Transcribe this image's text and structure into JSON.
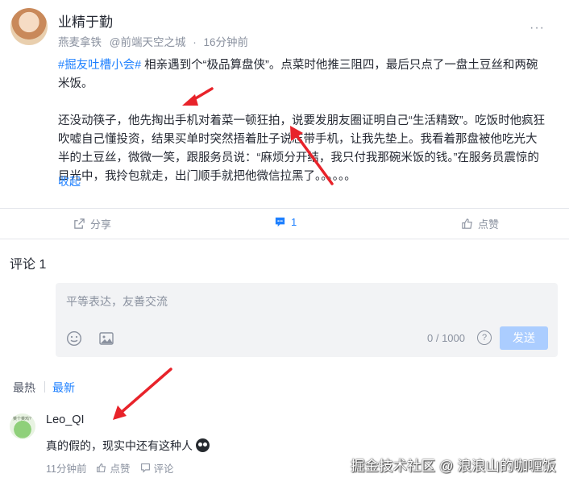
{
  "post": {
    "author": "业精于勤",
    "author_title": "燕麦拿铁",
    "circle": "@前端天空之城",
    "separator": "·",
    "time": "16分钟前",
    "more_icon": "more-dots-icon",
    "topic": "#掘友吐槽小会#",
    "text_line1": " 相亲遇到个“极品算盘侠”。点菜时他推三阻四，最后只点了一盘土豆丝和两碗米饭。",
    "text_para2": "还没动筷子，他先掏出手机对着菜一顿狂拍，说要发朋友圈证明自己“生活精致”。吃饭时他疯狂吹嘘自己懂投资，结果买单时突然捂着肚子说忘带手机，让我先垫上。我看着那盘被他吃光大半的土豆丝，微微一笑，跟服务员说：“麻烦分开结，我只付我那碗米饭的钱。”在服务员震惊的目光中，我拎包就走，出门顺手就把他微信拉黑了。。。。。。",
    "collapse_label": "收起"
  },
  "actions": {
    "share_label": "分享",
    "comment_count": "1",
    "like_label": "点赞",
    "accent": "#1e80ff"
  },
  "comments": {
    "title": "评论 1",
    "input_placeholder": "平等表达，友善交流",
    "counter": "0 / 1000",
    "help_symbol": "?",
    "send_label": "发送",
    "sort_hot": "最热",
    "sort_new": "最新",
    "items": [
      {
        "avatar_tag": "菜个菜鸡?",
        "name": "Leo_QI",
        "text": "真的假的，现实中还有这种人",
        "time": "11分钟前",
        "like_label": "点赞",
        "reply_label": "评论"
      }
    ]
  },
  "watermark": "掘金技术社区 @ 浪浪山的咖喱饭"
}
